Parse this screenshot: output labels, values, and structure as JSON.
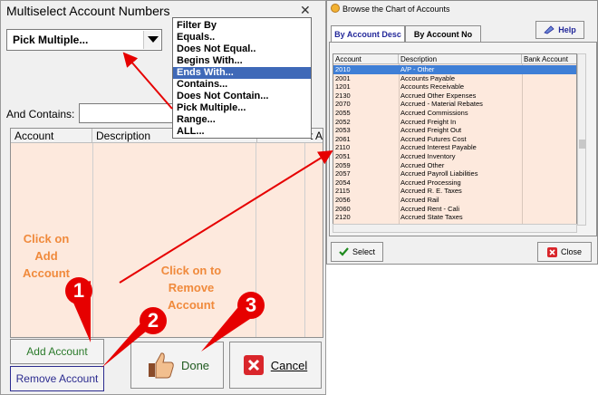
{
  "left_dialog": {
    "title": "Multiselect Account Numbers",
    "close_glyph": "✕",
    "combo_value": "Pick Multiple...",
    "contains_label": "And Contains:",
    "contains_value": "",
    "grid_headers": [
      "Account",
      "Description",
      "t A"
    ],
    "add_button": "Add Account",
    "remove_button": "Remove Account",
    "done_button": "Done",
    "cancel_button": "Cancel"
  },
  "filter_menu": {
    "header": "Filter By",
    "items": [
      "Equals..",
      "Does Not Equal..",
      "Begins With...",
      "Ends With...",
      "Contains...",
      "Does Not Contain...",
      "Pick Multiple...",
      "Range...",
      "ALL..."
    ],
    "selected_index": 3
  },
  "right_dialog": {
    "title": "Browse the Chart of Accounts",
    "tabs": [
      "By Account Desc",
      "By Account No"
    ],
    "help_button": "Help",
    "headers": [
      "Account",
      "Description",
      "Bank Account"
    ],
    "rows": [
      [
        "2010",
        "A/P - Other"
      ],
      [
        "2001",
        "Accounts Payable"
      ],
      [
        "1201",
        "Accounts Receivable"
      ],
      [
        "2130",
        "Accrued  Other Expenses"
      ],
      [
        "2070",
        "Accrued - Material Rebates"
      ],
      [
        "2055",
        "Accrued Commissions"
      ],
      [
        "2052",
        "Accrued Freight In"
      ],
      [
        "2053",
        "Accrued Freight Out"
      ],
      [
        "2061",
        "Accrued Futures Cost"
      ],
      [
        "2110",
        "Accrued Interest Payable"
      ],
      [
        "2051",
        "Accrued Inventory"
      ],
      [
        "2059",
        "Accrued Other"
      ],
      [
        "2057",
        "Accrued Payroll Liabilities"
      ],
      [
        "2054",
        "Accrued Processing"
      ],
      [
        "2115",
        "Accrued R. E. Taxes"
      ],
      [
        "2056",
        "Accrued Rail"
      ],
      [
        "2060",
        "Accrued Rent - Cali"
      ],
      [
        "2120",
        "Accrued State Taxes"
      ]
    ],
    "selected_row": 0,
    "select_button": "Select",
    "close_button": "Close"
  },
  "annotations": {
    "click_add": [
      "Click on",
      "Add",
      "Account"
    ],
    "click_remove": [
      "Click on to",
      "Remove",
      "Account"
    ],
    "callouts": [
      "1",
      "2",
      "3"
    ]
  },
  "colors": {
    "grid_bg": "#fde9dd",
    "selection": "#3f69b8",
    "annotation": "#f08a3c",
    "callout": "#e60000"
  }
}
